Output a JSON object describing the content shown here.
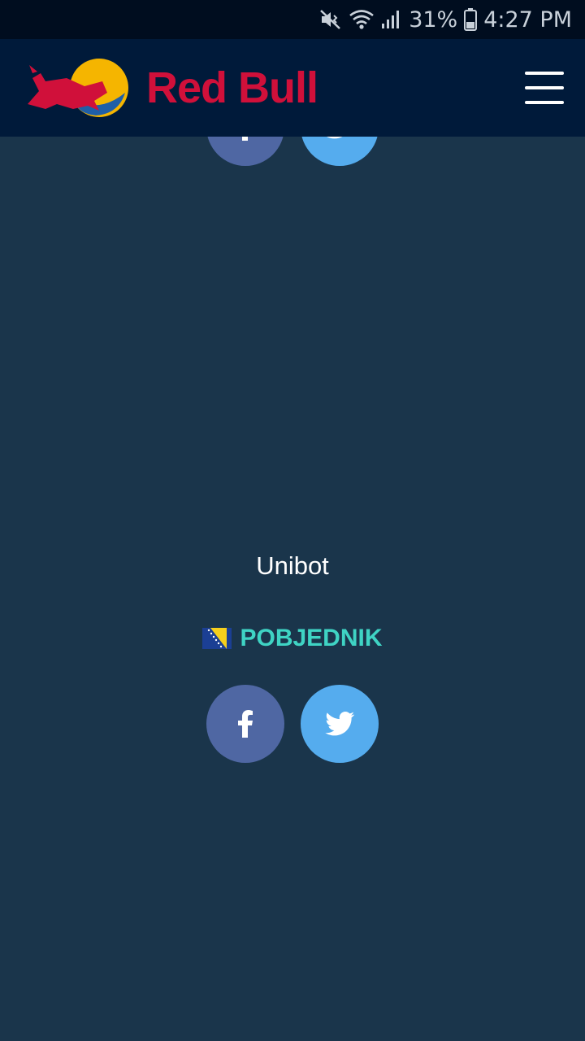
{
  "status_bar": {
    "battery_percent": "31%",
    "time": "4:27 PM",
    "icons": [
      "mute-icon",
      "wifi-icon",
      "signal-icon",
      "battery-icon"
    ]
  },
  "header": {
    "brand": "Red Bull",
    "menu_icon": "hamburger-icon",
    "colors": {
      "background": "#001a3a",
      "brand_red": "#d0103a",
      "brand_yellow": "#f5b500"
    }
  },
  "entry": {
    "name": "Unibot",
    "result_label": "POBJEDNIK",
    "flag_icon": "bosnia-flag-icon",
    "share": {
      "facebook_icon": "facebook-icon",
      "twitter_icon": "twitter-icon"
    }
  },
  "colors": {
    "page_background": "#1a354b",
    "facebook": "#4f67a3",
    "twitter": "#55acee",
    "accent": "#3fd4c4"
  }
}
